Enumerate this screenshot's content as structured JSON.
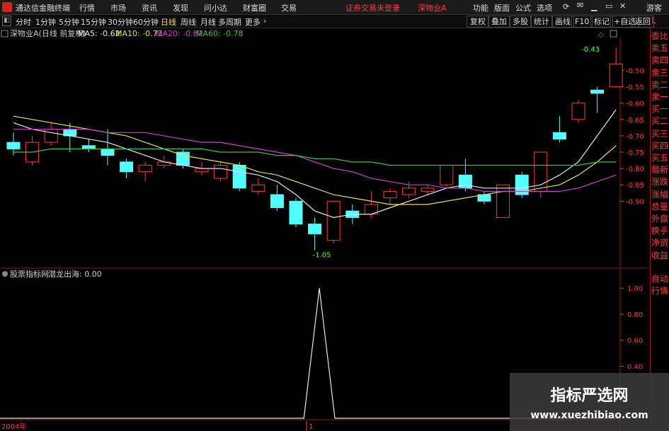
{
  "titlebar": {
    "app_title": "通达信金融终端",
    "menus": [
      "行情",
      "市场",
      "资讯",
      "发现",
      "问小达",
      "财富圈",
      "交易"
    ],
    "warning": "证券交易未登录",
    "stock_name": "深物业A",
    "right_menus": [
      "功能",
      "版面",
      "公式",
      "选项"
    ],
    "guest": "游客"
  },
  "toolbar": {
    "periods": [
      "分时",
      "1分钟",
      "5分钟",
      "15分钟",
      "30分钟",
      "60分钟",
      "日线",
      "周线",
      "月线",
      "多周期",
      "更多"
    ],
    "selected_period": "日线",
    "tools": [
      "复权",
      "叠加",
      "多股",
      "统计",
      "画线",
      "F10",
      "标记",
      "+自选",
      "返回"
    ]
  },
  "sidebar": {
    "top": "L",
    "items": [
      "委比",
      "卖五",
      "卖四",
      "卖三",
      "卖二",
      "卖一",
      "买一",
      "买二",
      "买三",
      "买四",
      "买五",
      "最新",
      "涨跌",
      "涨幅",
      "总量",
      "外盘",
      "换手",
      "净资",
      "收益"
    ],
    "lower_items": [
      "自动",
      "行情"
    ]
  },
  "main_chart": {
    "info_name": "深物业A(日线 前复权)",
    "ma": [
      {
        "label": "MA5: -0.62",
        "color": "#e8e8e8"
      },
      {
        "label": "MA10: -0.73",
        "color": "#e8e050"
      },
      {
        "label": "MA20: -0.82",
        "color": "#d040d0"
      },
      {
        "label": "MA60: -0.78",
        "color": "#40c040"
      }
    ],
    "high_label": "-0.43",
    "low_label": "-1.05",
    "y_labels": [
      "-0.50",
      "-0.55",
      "-0.60",
      "-0.65",
      "-0.70",
      "-0.75",
      "-0.80",
      "-0.85",
      "-0.90"
    ]
  },
  "sub_chart": {
    "info_name": "股票指标网",
    "indicator": "潜龙出海: 0.00",
    "y_labels": [
      "1.00",
      "0.80",
      "0.60",
      "0.40"
    ]
  },
  "bottom": {
    "year": "2004年",
    "marker": "1"
  },
  "watermark": {
    "title": "指标严选网",
    "url": "www.xuezhibiao.com"
  },
  "colors": {
    "up": "#ff3a3a",
    "down": "#54ffff",
    "axis": "#8a1c1c"
  },
  "chart_data": {
    "type": "candlestick",
    "ylim": [
      -1.09,
      -0.41
    ],
    "candles": [
      {
        "o": -0.72,
        "c": -0.74,
        "h": -0.69,
        "l": -0.76
      },
      {
        "o": -0.78,
        "c": -0.72,
        "h": -0.7,
        "l": -0.79
      },
      {
        "o": -0.72,
        "c": -0.68,
        "h": -0.66,
        "l": -0.73
      },
      {
        "o": -0.68,
        "c": -0.7,
        "h": -0.66,
        "l": -0.75
      },
      {
        "o": -0.73,
        "c": -0.74,
        "h": -0.71,
        "l": -0.75
      },
      {
        "o": -0.74,
        "c": -0.76,
        "h": -0.68,
        "l": -0.79
      },
      {
        "o": -0.78,
        "c": -0.81,
        "h": -0.77,
        "l": -0.83
      },
      {
        "o": -0.81,
        "c": -0.79,
        "h": -0.78,
        "l": -0.84
      },
      {
        "o": -0.79,
        "c": -0.78,
        "h": -0.76,
        "l": -0.8
      },
      {
        "o": -0.75,
        "c": -0.79,
        "h": -0.74,
        "l": -0.8
      },
      {
        "o": -0.81,
        "c": -0.8,
        "h": -0.78,
        "l": -0.82
      },
      {
        "o": -0.83,
        "c": -0.79,
        "h": -0.78,
        "l": -0.84
      },
      {
        "o": -0.79,
        "c": -0.86,
        "h": -0.78,
        "l": -0.87
      },
      {
        "o": -0.87,
        "c": -0.85,
        "h": -0.83,
        "l": -0.88
      },
      {
        "o": -0.88,
        "c": -0.92,
        "h": -0.85,
        "l": -0.93
      },
      {
        "o": -0.9,
        "c": -0.97,
        "h": -0.89,
        "l": -0.98
      },
      {
        "o": -0.97,
        "c": -1.0,
        "h": -0.95,
        "l": -1.05
      },
      {
        "o": -1.02,
        "c": -0.9,
        "h": -0.9,
        "l": -1.03
      },
      {
        "o": -0.93,
        "c": -0.95,
        "h": -0.91,
        "l": -0.97
      },
      {
        "o": -0.94,
        "c": -0.91,
        "h": -0.87,
        "l": -0.95
      },
      {
        "o": -0.89,
        "c": -0.87,
        "h": -0.86,
        "l": -0.91
      },
      {
        "o": -0.88,
        "c": -0.86,
        "h": -0.84,
        "l": -0.89
      },
      {
        "o": -0.87,
        "c": -0.86,
        "h": -0.85,
        "l": -0.88
      },
      {
        "o": -0.85,
        "c": -0.79,
        "h": -0.79,
        "l": -0.86
      },
      {
        "o": -0.82,
        "c": -0.86,
        "h": -0.77,
        "l": -0.87
      },
      {
        "o": -0.88,
        "c": -0.9,
        "h": -0.87,
        "l": -0.91
      },
      {
        "o": -0.95,
        "c": -0.85,
        "h": -0.85,
        "l": -0.95
      },
      {
        "o": -0.82,
        "c": -0.88,
        "h": -0.81,
        "l": -0.89
      },
      {
        "o": -0.87,
        "c": -0.75,
        "h": -0.75,
        "l": -0.89
      },
      {
        "o": -0.69,
        "c": -0.71,
        "h": -0.64,
        "l": -0.72
      },
      {
        "o": -0.65,
        "c": -0.6,
        "h": -0.59,
        "l": -0.66
      },
      {
        "o": -0.56,
        "c": -0.57,
        "h": -0.55,
        "l": -0.63
      },
      {
        "o": -0.55,
        "c": -0.48,
        "h": -0.43,
        "l": -0.55
      }
    ],
    "ma5": [
      -0.66,
      -0.68,
      -0.69,
      -0.7,
      -0.71,
      -0.72,
      -0.74,
      -0.76,
      -0.78,
      -0.79,
      -0.8,
      -0.8,
      -0.81,
      -0.82,
      -0.84,
      -0.88,
      -0.93,
      -0.95,
      -0.94,
      -0.94,
      -0.92,
      -0.9,
      -0.88,
      -0.86,
      -0.85,
      -0.86,
      -0.86,
      -0.86,
      -0.85,
      -0.82,
      -0.78,
      -0.7,
      -0.62
    ],
    "ma10": [
      -0.64,
      -0.65,
      -0.66,
      -0.67,
      -0.68,
      -0.69,
      -0.7,
      -0.72,
      -0.74,
      -0.76,
      -0.77,
      -0.78,
      -0.79,
      -0.81,
      -0.82,
      -0.84,
      -0.86,
      -0.88,
      -0.89,
      -0.9,
      -0.91,
      -0.91,
      -0.91,
      -0.9,
      -0.89,
      -0.88,
      -0.87,
      -0.87,
      -0.86,
      -0.85,
      -0.82,
      -0.78,
      -0.73
    ],
    "ma20": [
      -0.68,
      -0.68,
      -0.68,
      -0.68,
      -0.68,
      -0.69,
      -0.69,
      -0.69,
      -0.7,
      -0.71,
      -0.72,
      -0.72,
      -0.73,
      -0.74,
      -0.75,
      -0.76,
      -0.78,
      -0.8,
      -0.81,
      -0.83,
      -0.84,
      -0.85,
      -0.85,
      -0.86,
      -0.86,
      -0.87,
      -0.87,
      -0.87,
      -0.87,
      -0.87,
      -0.86,
      -0.84,
      -0.82
    ],
    "ma60": [
      -0.75,
      -0.75,
      -0.74,
      -0.74,
      -0.74,
      -0.74,
      -0.74,
      -0.74,
      -0.74,
      -0.74,
      -0.74,
      -0.75,
      -0.75,
      -0.75,
      -0.76,
      -0.76,
      -0.77,
      -0.77,
      -0.78,
      -0.78,
      -0.79,
      -0.79,
      -0.79,
      -0.79,
      -0.79,
      -0.79,
      -0.79,
      -0.79,
      -0.79,
      -0.79,
      -0.79,
      -0.78,
      -0.78
    ],
    "signal": {
      "ylim": [
        0,
        1.05
      ],
      "x": [
        0,
        0.49,
        0.515,
        0.54,
        1
      ],
      "values": [
        0,
        0,
        1.0,
        0,
        0
      ]
    }
  }
}
